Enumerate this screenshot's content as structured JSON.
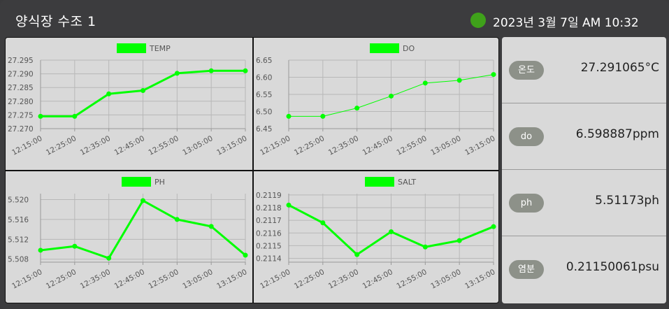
{
  "header": {
    "title": "양식장 수조 1",
    "datetime": "2023년 3월 7일 AM 10:32",
    "status_color": "#3fa11a"
  },
  "sensors": [
    {
      "label": "온도",
      "value": "27.291065°C"
    },
    {
      "label": "do",
      "value": "6.598887ppm"
    },
    {
      "label": "ph",
      "value": "5.51173ph"
    },
    {
      "label": "염분",
      "value": "0.21150061psu"
    }
  ],
  "chart_data": [
    {
      "type": "line",
      "series": [
        {
          "name": "TEMP",
          "values": [
            27.2745,
            27.2745,
            27.2827,
            27.2839,
            27.2902,
            27.2911,
            27.2911
          ]
        }
      ],
      "x": [
        "12:15:00",
        "12:25:00",
        "12:35:00",
        "12:45:00",
        "12:55:00",
        "13:05:00",
        "13:15:00"
      ],
      "yticks": [
        "27.295",
        "27.290",
        "27.285",
        "27.280",
        "27.275",
        "27.270"
      ],
      "ylim": [
        27.27,
        27.295
      ],
      "color": "#00ff00",
      "line_width": 3,
      "grid": true,
      "legend": "top-center"
    },
    {
      "type": "line",
      "series": [
        {
          "name": "DO",
          "values": [
            6.486,
            6.486,
            6.51,
            6.545,
            6.583,
            6.591,
            6.608
          ]
        }
      ],
      "x": [
        "12:15:00",
        "12:25:00",
        "12:35:00",
        "12:45:00",
        "12:55:00",
        "13:05:00",
        "13:15:00"
      ],
      "yticks": [
        "6.65",
        "6.60",
        "6.55",
        "6.50",
        "6.45"
      ],
      "ylim": [
        6.45,
        6.65
      ],
      "color": "#00ff00",
      "line_width": 1,
      "grid": true,
      "legend": "top-center"
    },
    {
      "type": "line",
      "series": [
        {
          "name": "PH",
          "values": [
            5.5098,
            5.5106,
            5.5082,
            5.5198,
            5.516,
            5.5146,
            5.5088
          ]
        }
      ],
      "x": [
        "12:15:00",
        "12:25:00",
        "12:35:00",
        "12:45:00",
        "12:55:00",
        "13:05:00",
        "13:15:00"
      ],
      "yticks": [
        "5.520",
        "5.516",
        "5.512",
        "5.508"
      ],
      "ylim": [
        5.5074,
        5.5212
      ],
      "color": "#00ff00",
      "line_width": 3,
      "grid": true,
      "legend": "top-center"
    },
    {
      "type": "line",
      "series": [
        {
          "name": "SALT",
          "values": [
            0.21182,
            0.21168,
            0.21143,
            0.21161,
            0.21149,
            0.21154,
            0.21165
          ]
        }
      ],
      "x": [
        "12:15:00",
        "12:25:00",
        "12:35:00",
        "12:45:00",
        "12:55:00",
        "13:05:00",
        "13:15:00"
      ],
      "yticks": [
        "0.2119",
        "0.2118",
        "0.2117",
        "0.2116",
        "0.2115",
        "0.2114"
      ],
      "ylim": [
        0.21137,
        0.21191
      ],
      "color": "#00ff00",
      "line_width": 3,
      "grid": true,
      "legend": "top-center"
    }
  ]
}
